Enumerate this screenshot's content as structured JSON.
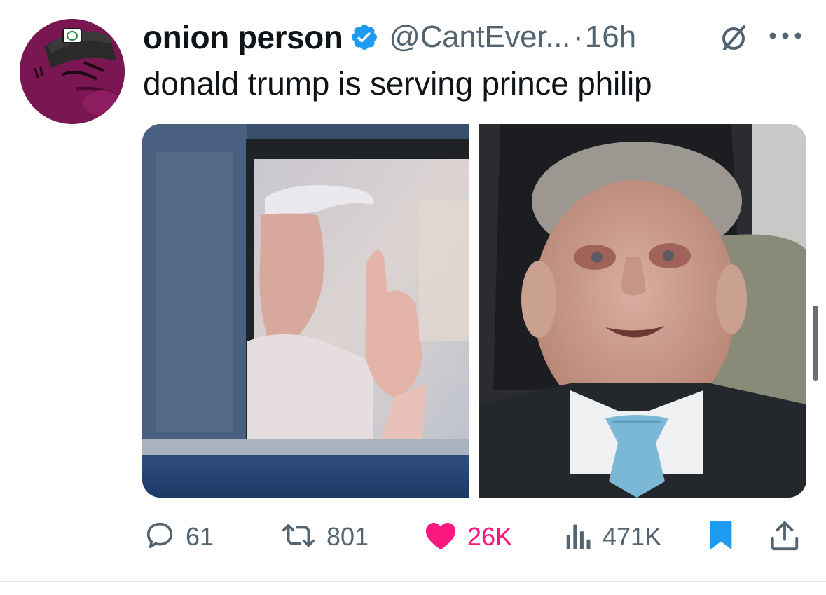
{
  "tweet": {
    "display_name": "onion person",
    "handle": "@CantEver...",
    "separator": "·",
    "time": "16h",
    "text": "donald trump is serving prince philip",
    "verified": true
  },
  "icons": {
    "avatar": "onion-logo-avatar",
    "verified": "verified-badge-icon",
    "grok": "grok-icon",
    "more": "more-icon",
    "reply": "reply-icon",
    "retweet": "retweet-icon",
    "like": "heart-icon",
    "views": "views-icon",
    "bookmark": "bookmark-icon",
    "share": "share-icon"
  },
  "media": {
    "count": 2,
    "left_image": "man in white cap waving from car window",
    "right_image": "elderly man in car seat wearing blue tie"
  },
  "actions": {
    "replies": "61",
    "retweets": "801",
    "likes": "26K",
    "views": "471K"
  },
  "colors": {
    "text": "#0f1419",
    "secondary": "#536471",
    "verified": "#1d9bf0",
    "like": "#f91880",
    "bookmark": "#1d9bf0",
    "avatar_bg": "#7a1652"
  }
}
